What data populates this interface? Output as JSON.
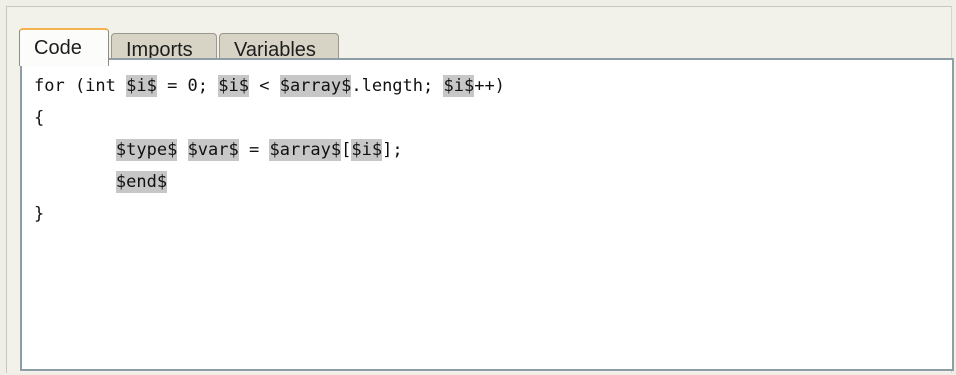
{
  "tabs": [
    {
      "label": "Code",
      "active": true
    },
    {
      "label": "Imports",
      "active": false
    },
    {
      "label": "Variables",
      "active": false
    }
  ],
  "editor": {
    "code_lines": [
      [
        {
          "t": "for (int "
        },
        {
          "t": "$i$",
          "ph": true
        },
        {
          "t": " = 0; "
        },
        {
          "t": "$i$",
          "ph": true
        },
        {
          "t": " < "
        },
        {
          "t": "$array$",
          "ph": true
        },
        {
          "t": ".length; "
        },
        {
          "t": "$i$",
          "ph": true
        },
        {
          "t": "++)"
        }
      ],
      [
        {
          "t": "{"
        }
      ],
      [
        {
          "t": "        "
        },
        {
          "t": "$type$",
          "ph": true
        },
        {
          "t": " "
        },
        {
          "t": "$var$",
          "ph": true
        },
        {
          "t": " = "
        },
        {
          "t": "$array$",
          "ph": true
        },
        {
          "t": "["
        },
        {
          "t": "$i$",
          "ph": true
        },
        {
          "t": "];"
        }
      ],
      [
        {
          "t": "        "
        },
        {
          "t": "$end$",
          "ph": true
        }
      ],
      [
        {
          "t": "}"
        }
      ]
    ]
  }
}
